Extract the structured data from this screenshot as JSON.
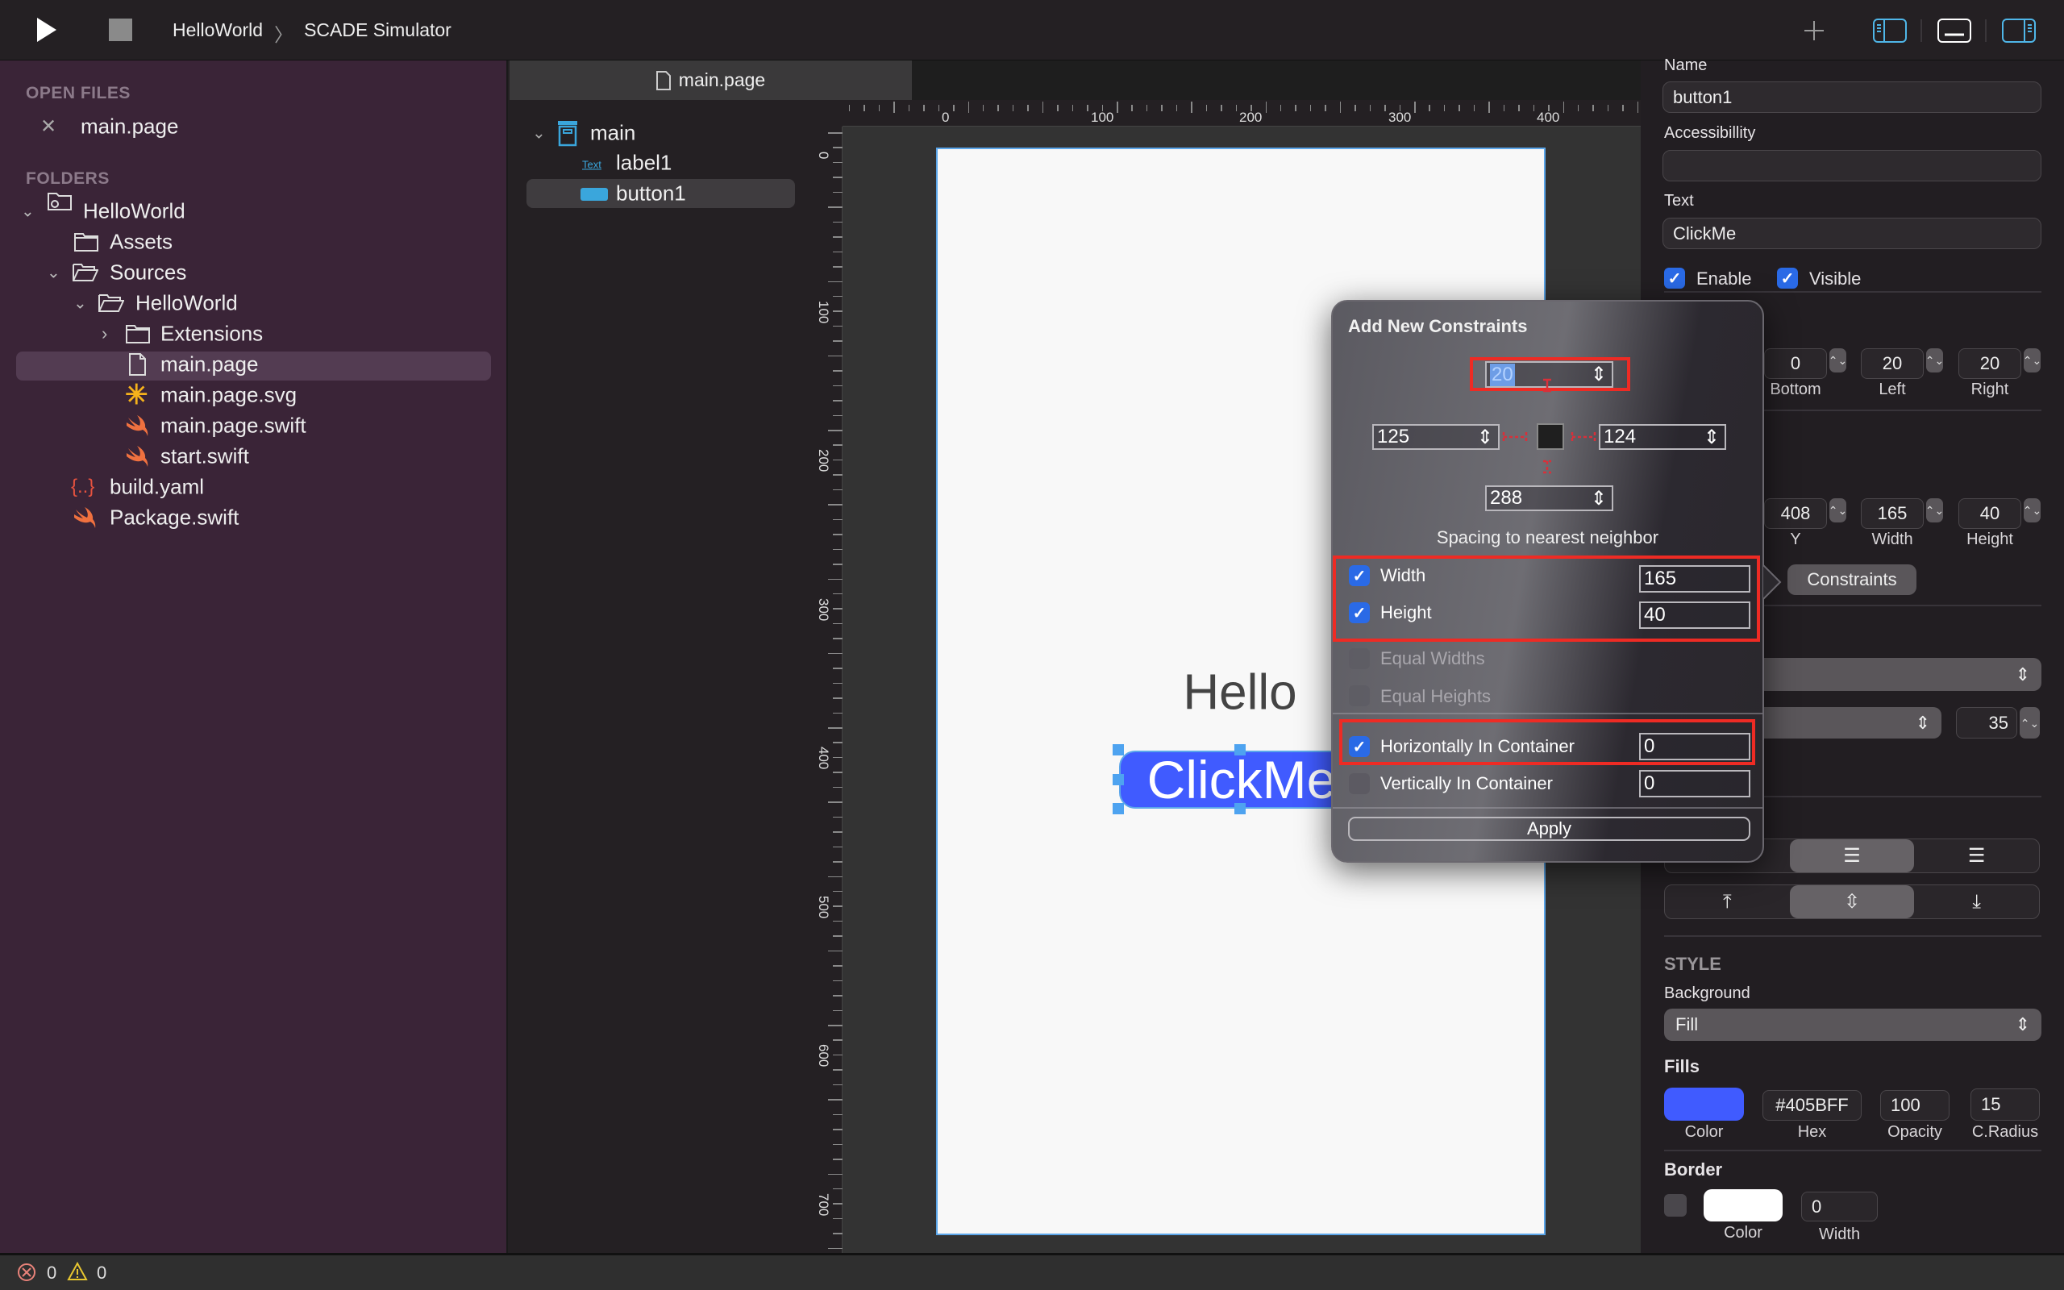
{
  "toolbar": {
    "project": "HelloWorld",
    "separator": "〉",
    "target": "SCADE Simulator",
    "icons": [
      "play-icon",
      "stop-icon",
      "plus-icon",
      "left-panel-icon",
      "bottom-panel-icon",
      "right-panel-icon"
    ]
  },
  "sidebar": {
    "open_files_title": "OPEN FILES",
    "open_files": [
      {
        "label": "main.page"
      }
    ],
    "folders_title": "FOLDERS",
    "tree": [
      {
        "label": "HelloWorld",
        "icon": "project-folder-icon"
      },
      {
        "label": "Assets",
        "icon": "folder-icon"
      },
      {
        "label": "Sources",
        "icon": "folder-open-icon"
      },
      {
        "label": "HelloWorld",
        "icon": "folder-open-icon"
      },
      {
        "label": "Extensions",
        "icon": "folder-icon"
      },
      {
        "label": "main.page",
        "icon": "file-icon",
        "selected": true
      },
      {
        "label": "main.page.svg",
        "icon": "svg-icon"
      },
      {
        "label": "main.page.swift",
        "icon": "swift-icon"
      },
      {
        "label": "start.swift",
        "icon": "swift-icon"
      },
      {
        "label": "build.yaml",
        "icon": "yaml-icon"
      },
      {
        "label": "Package.swift",
        "icon": "swift-icon"
      }
    ]
  },
  "editor": {
    "tab": "main.page"
  },
  "outline": {
    "items": [
      {
        "label": "main"
      },
      {
        "label": "label1",
        "icon_text": "Text"
      },
      {
        "label": "button1",
        "selected": true
      }
    ]
  },
  "rulers": {
    "top": [
      "0",
      "0",
      "100",
      "200",
      "300",
      "400"
    ],
    "left": [
      "0",
      "100",
      "200",
      "300",
      "400",
      "500",
      "600",
      "700"
    ]
  },
  "canvas": {
    "label_text": "Hello",
    "button_text": "ClickMe",
    "button_color": "#405BFF"
  },
  "popup": {
    "title": "Add New Constraints",
    "top": "20",
    "left": "125",
    "right": "124",
    "bottom": "288",
    "spacing_label": "Spacing to nearest neighbor",
    "options": [
      {
        "label": "Width",
        "checked": true,
        "value": "165"
      },
      {
        "label": "Height",
        "checked": true,
        "value": "40"
      },
      {
        "label": "Equal Widths",
        "checked": false
      },
      {
        "label": "Equal Heights",
        "checked": false
      },
      {
        "label": "Horizontally In Container",
        "checked": true,
        "value": "0"
      },
      {
        "label": "Vertically In Container",
        "checked": false,
        "value": "0"
      }
    ],
    "apply": "Apply"
  },
  "inspector": {
    "name_label": "Name",
    "name_value": "button1",
    "accessibility_label": "Accessibillity",
    "accessibility_value": "",
    "text_label": "Text",
    "text_value": "ClickMe",
    "enable_label": "Enable",
    "visible_label": "Visible",
    "margins": [
      {
        "label": "Bottom",
        "value": "0"
      },
      {
        "label": "Left",
        "value": "20"
      },
      {
        "label": "Right",
        "value": "20"
      }
    ],
    "frame": [
      {
        "label": "Y",
        "value": "408"
      },
      {
        "label": "Width",
        "value": "165"
      },
      {
        "label": "Height",
        "value": "40"
      }
    ],
    "constraints_button": "Constraints",
    "font_size": "35",
    "style_title": "STYLE",
    "background_label": "Background",
    "background_value": "Fill",
    "fills_label": "Fills",
    "fill": {
      "color": "#405BFF",
      "hex": "#405BFF",
      "opacity": "100",
      "radius": "15",
      "color_label": "Color",
      "hex_label": "Hex",
      "opacity_label": "Opacity",
      "radius_label": "C.Radius"
    },
    "border_label": "Border",
    "border": {
      "color": "#FFFFFF",
      "width": "0",
      "color_label": "Color",
      "width_label": "Width"
    }
  },
  "status": {
    "errors": "0",
    "warnings": "0"
  }
}
